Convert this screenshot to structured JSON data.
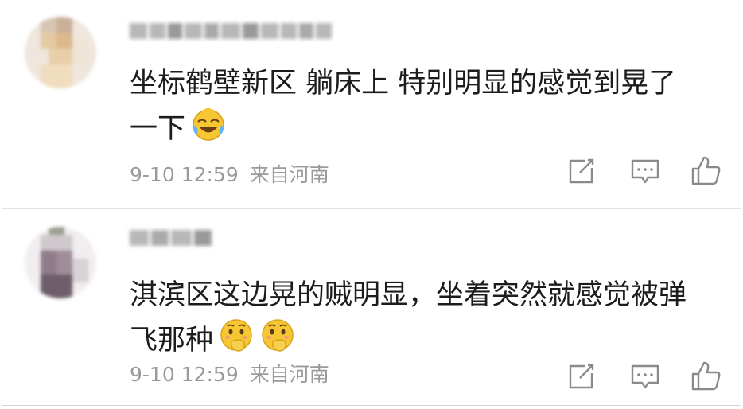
{
  "comments": [
    {
      "text_line1": "坐标鹤壁新区 躺床上 特别明显的感觉到晃了",
      "text_line2": "一下",
      "emoji": "laughing-crying-emoji",
      "date": "9-10 12:59",
      "location": "来自河南"
    },
    {
      "text_line1": "淇滨区这边晃的贼明显，坐着突然就感觉被弹",
      "text_line2": "飞那种",
      "emoji": "covering-mouth-emoji",
      "date": "9-10 12:59",
      "location": "来自河南"
    }
  ],
  "icons": {
    "share": "share-icon",
    "reply": "comment-icon",
    "like": "thumbs-up-icon"
  },
  "colors": {
    "text": "#1c1c1c",
    "meta": "#9a9a9a",
    "icon": "#8a8a8a",
    "emoji": "#f6c733"
  }
}
